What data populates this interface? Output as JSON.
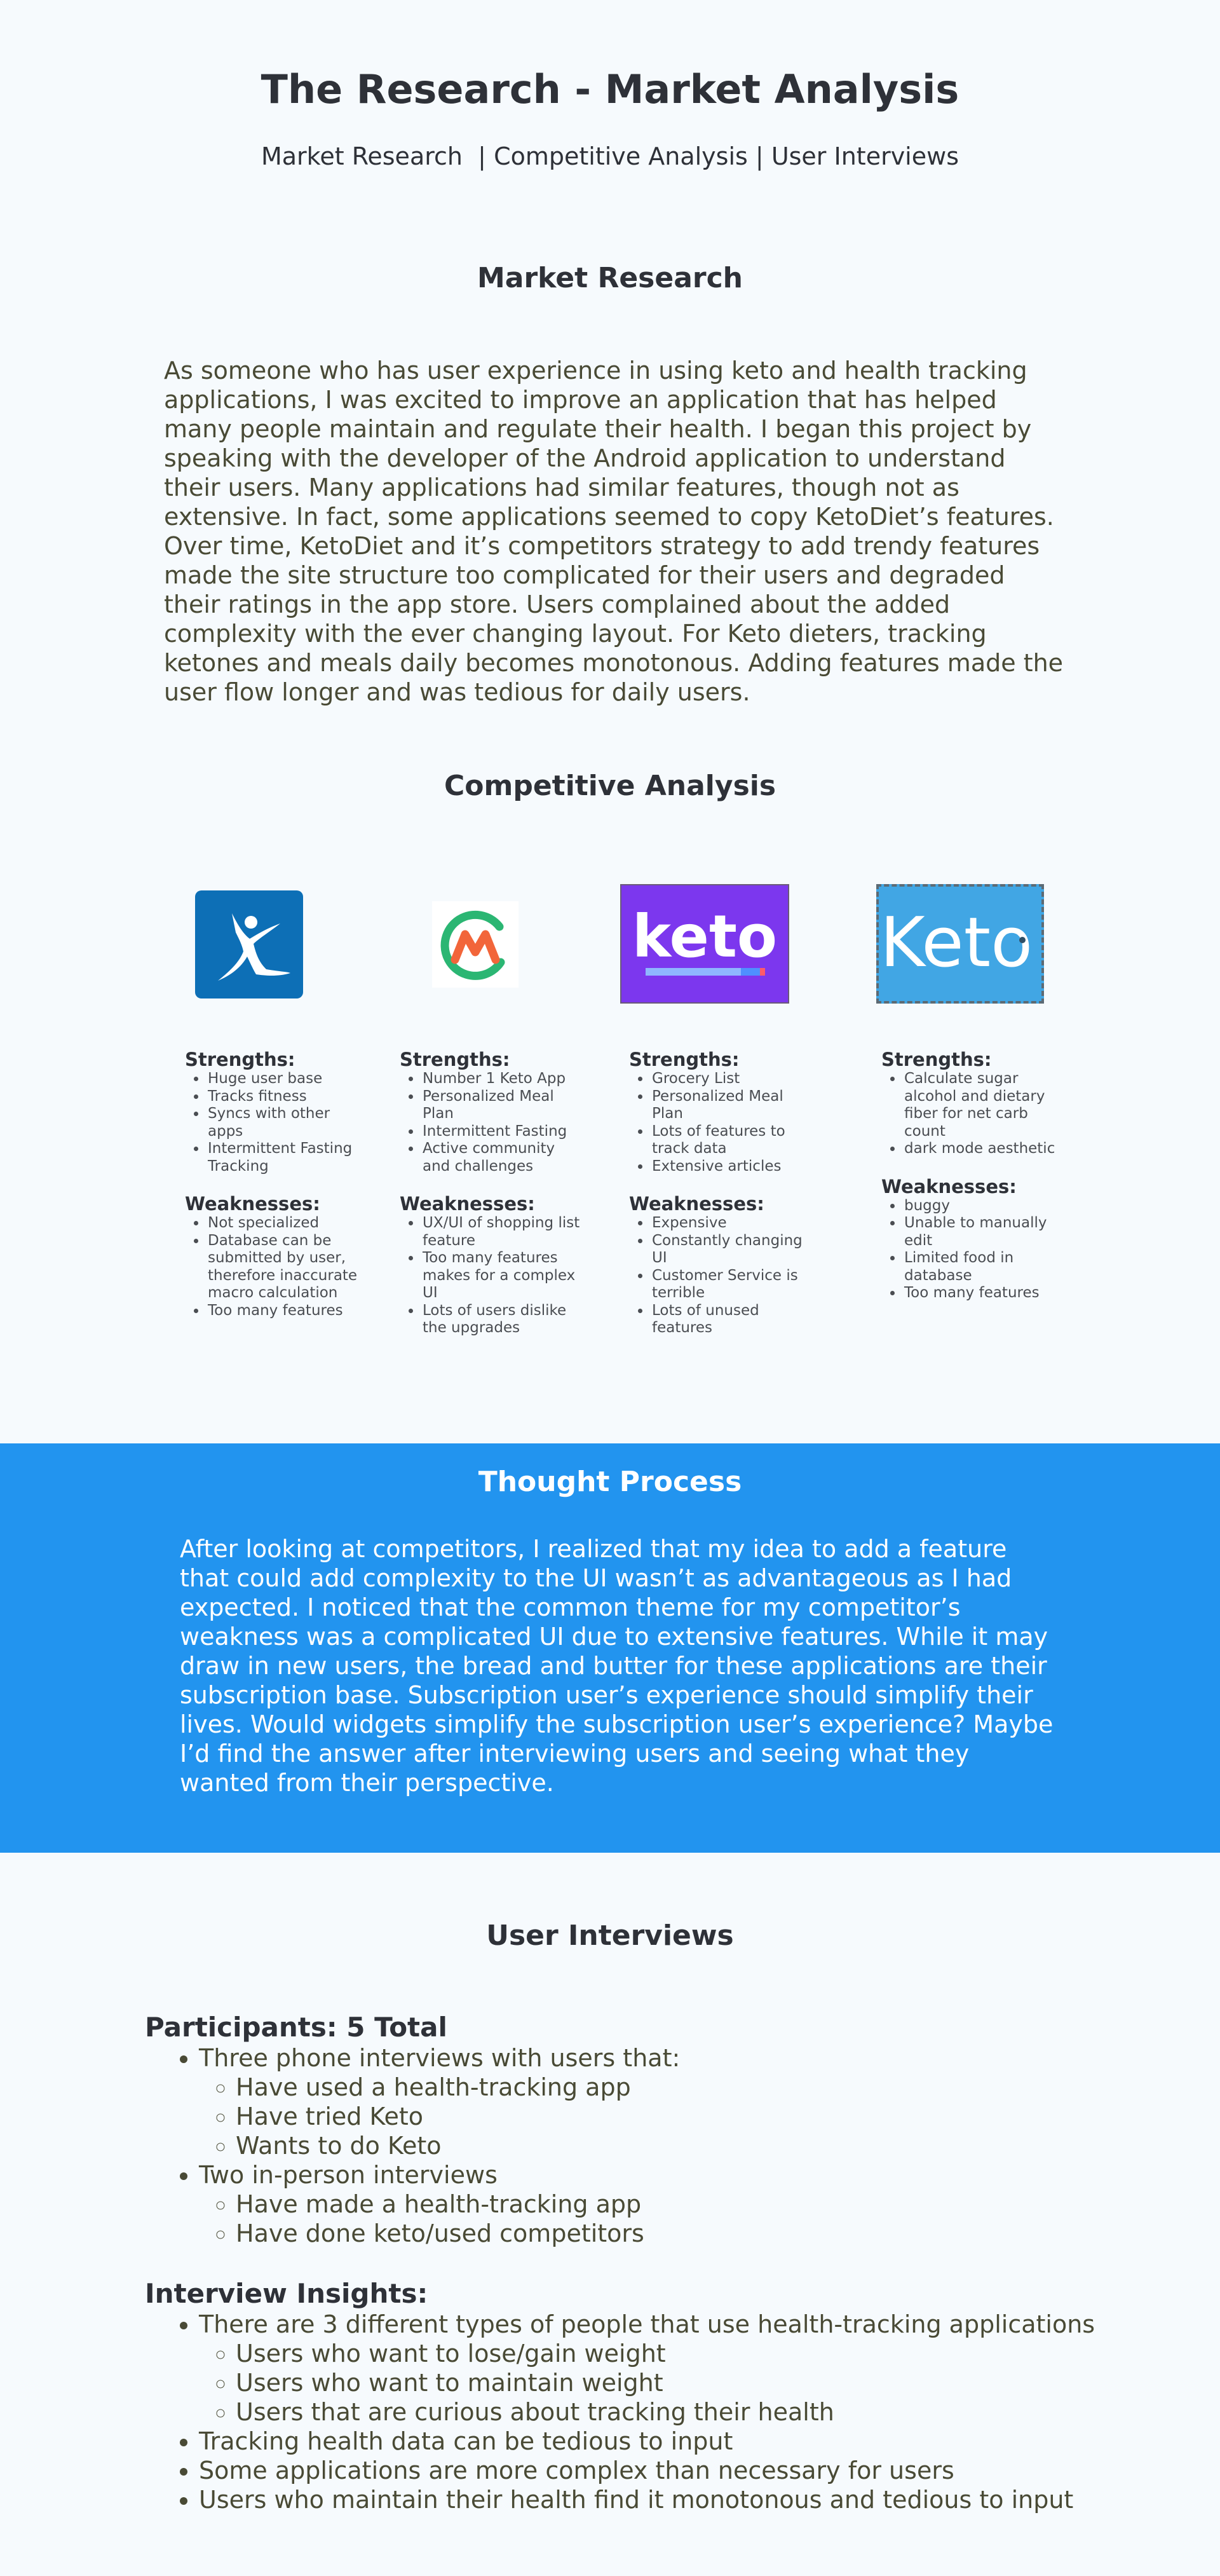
{
  "header": {
    "title": "The Research - Market Analysis",
    "nav": {
      "market_research": "Market Research",
      "competitive_analysis": "Competitive Analysis",
      "user_interviews": "User Interviews"
    }
  },
  "market_research": {
    "title": "Market Research",
    "body": "As someone who has user experience  in using keto and health tracking applications, I was excited to improve an application that has helped many people maintain and regulate their health. I began this project by speaking with the developer of the Android application to understand their users. Many applications had similar features, though  not as extensive. In fact, some applications seemed to copy KetoDiet’s features. Over time, KetoDiet and it’s competitors strategy to add trendy features made the site structure too complicated for their users and degraded their ratings in the app store. Users complained about the added complexity with the ever changing layout. For Keto dieters, tracking ketones and meals daily becomes monotonous. Adding features made the user flow longer and was tedious for daily users."
  },
  "competitive_analysis": {
    "title": "Competitive Analysis",
    "logos": {
      "keto_text": "keto",
      "keto2_text": "Keto"
    },
    "competitors": [
      {
        "strengths_label": "Strengths:",
        "strengths": [
          "Huge user base",
          "Tracks fitness",
          "Syncs with other apps",
          "Intermittent Fasting Tracking"
        ],
        "weaknesses_label": "Weaknesses:",
        "weaknesses": [
          "Not specialized",
          "Database can be submitted by user, therefore inaccurate macro calculation",
          "Too many features"
        ]
      },
      {
        "strengths_label": "Strengths:",
        "strengths": [
          "Number 1 Keto App",
          "Personalized Meal Plan",
          "Intermittent Fasting",
          "Active community and challenges"
        ],
        "weaknesses_label": "Weaknesses:",
        "weaknesses": [
          "UX/UI of shopping list feature",
          "Too many features makes for a complex UI",
          "Lots of users dislike the upgrades"
        ]
      },
      {
        "strengths_label": "Strengths:",
        "strengths": [
          "Grocery List",
          "Personalized Meal Plan",
          "Lots of features to track data",
          "Extensive articles"
        ],
        "weaknesses_label": "Weaknesses:",
        "weaknesses": [
          "Expensive",
          "Constantly changing UI",
          "Customer Service is terrible",
          "Lots of unused features"
        ]
      },
      {
        "strengths_label": "Strengths:",
        "strengths": [
          "Calculate sugar alcohol and dietary fiber for net carb count",
          "dark mode aesthetic"
        ],
        "weaknesses_label": "Weaknesses:",
        "weaknesses": [
          "buggy",
          "Unable to manually edit",
          "Limited food in database",
          "Too many features"
        ]
      }
    ]
  },
  "thought_process": {
    "title": "Thought Process",
    "body": "After looking at competitors, I realized that my idea to add a feature that could add complexity to the UI wasn’t as advantageous as I had expected. I noticed that the common theme for my competitor’s weakness was a complicated UI due to extensive features. While it may draw in new users, the bread and butter for these applications are their subscription base. Subscription user’s experience should simplify their lives. Would widgets simplify the subscription user’s experience? Maybe I’d find the answer after interviewing users and seeing what they wanted from their perspective."
  },
  "user_interviews": {
    "title": "User Interviews",
    "participants": {
      "heading": "Participants: 5 Total",
      "groups": [
        {
          "label": "Three phone interviews with users that:",
          "items": [
            "Have used a health-tracking app",
            "Have tried Keto",
            "Wants to do Keto"
          ]
        },
        {
          "label": "Two in-person interviews",
          "items": [
            "Have made a health-tracking app",
            "Have done keto/used competitors"
          ]
        }
      ]
    },
    "insights": {
      "heading": "Interview Insights:",
      "first": "There are 3 different types of people that use health-tracking applications",
      "types": [
        "Users who want to lose/gain weight",
        "Users who want to maintain weight",
        "Users that are curious about tracking their health"
      ],
      "others": [
        "Tracking health data can be tedious to input",
        "Some applications are more complex than necessary for users",
        "Users who maintain their health find it monotonous and tedious to input"
      ]
    }
  },
  "colors": {
    "background": "#f6fafd",
    "heading": "#2e3138",
    "body_text": "#494a35",
    "band": "#2294ef",
    "mfp_logo": "#0d6fb6",
    "keto_logo": "#7c37ee",
    "keto2_logo": "#41a6e4"
  }
}
